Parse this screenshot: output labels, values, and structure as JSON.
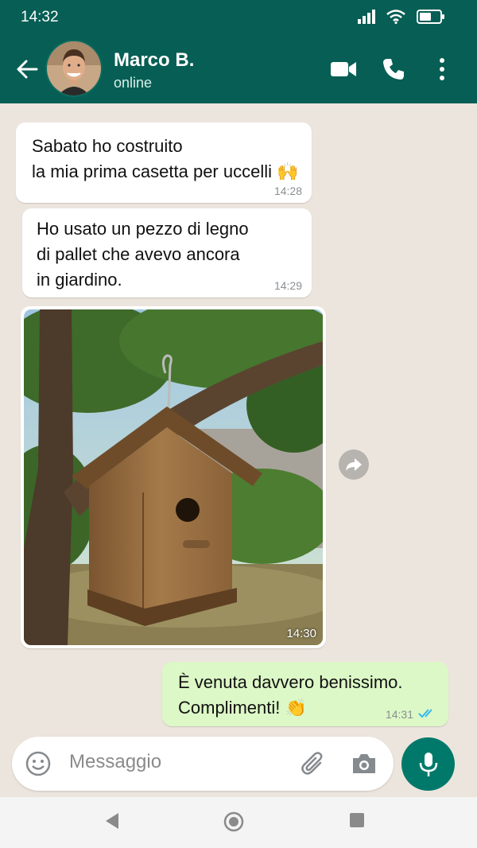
{
  "status": {
    "time": "14:32"
  },
  "header": {
    "contact_name": "Marco B.",
    "contact_status": "online"
  },
  "messages": [
    {
      "direction": "in",
      "text": "Sabato ho costruito\nla mia prima casetta per uccelli 🙌",
      "time": "14:28"
    },
    {
      "direction": "in",
      "text": "Ho usato un pezzo di legno\ndi pallet che avevo ancora\nin giardino.",
      "time": "14:29"
    },
    {
      "direction": "in",
      "type": "image",
      "time": "14:30"
    },
    {
      "direction": "out",
      "text": "È venuta davvero benissimo.\nComplimenti! 👏",
      "time": "14:31",
      "read": true
    }
  ],
  "composer": {
    "placeholder": "Messaggio"
  },
  "colors": {
    "header": "#075E54",
    "chat_bg": "#ECE5DD",
    "outgoing_bubble": "#DCF8C6",
    "mic_button": "#00796B",
    "read_ticks": "#34B7F1"
  },
  "icons": [
    "back-arrow-icon",
    "video-call-icon",
    "phone-icon",
    "more-vert-icon",
    "forward-icon",
    "emoji-icon",
    "attach-icon",
    "camera-icon",
    "mic-icon",
    "nav-back-icon",
    "nav-home-icon",
    "nav-recents-icon"
  ]
}
